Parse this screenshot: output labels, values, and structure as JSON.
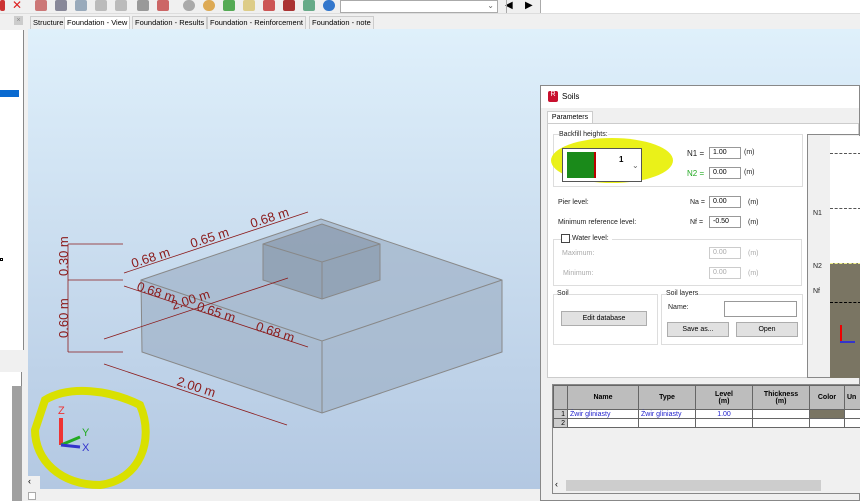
{
  "toolbar": {
    "icons": [
      "close-icon",
      "scissors-icon",
      "copy-icon",
      "paste-icon",
      "undo-icon",
      "redo-icon",
      "frame-icon",
      "table-icon",
      "zoom-icon",
      "zoom-window-icon",
      "axes-icon",
      "note-icon",
      "tools-icon",
      "wrench-icon",
      "users-icon",
      "help-icon"
    ],
    "combo_value": ""
  },
  "tabs": [
    "Structure",
    "Foundation - View",
    "Foundation - Results",
    "Foundation - Reinforcement",
    "Foundation - note"
  ],
  "view": {
    "dims": {
      "h1": "0.30 m",
      "h2": "0.60 m",
      "top1": "0.68 m",
      "top2": "0.65 m",
      "top3": "0.68 m",
      "mid1": "0.68 m",
      "mid2": "0.65 m",
      "mid3": "0.68 m",
      "mid_total": "2.00 m",
      "bottom": "2.00 m"
    },
    "axes": {
      "z": "Z",
      "y": "Y",
      "x": "X"
    }
  },
  "dialog": {
    "title": "Soils",
    "tab": "Parameters",
    "backfill_label": "Backfill heights:",
    "backfill_value": "1",
    "n1_label": "N1 =",
    "n1": "1.00",
    "n2_label": "N2 =",
    "n2": "0.00",
    "unit": "(m)",
    "pier_label": "Pier level:",
    "na_label": "Na =",
    "na": "0.00",
    "minref_label": "Minimum reference level:",
    "nf_label": "Nf =",
    "nf": "-0.50",
    "water_label": "Water level:",
    "max_label": "Maximum:",
    "max": "0.00",
    "min_label": "Minimum:",
    "min": "0.00",
    "soil_group": "Soil",
    "edit_db": "Edit database",
    "layers_group": "Soil layers",
    "name_label": "Name:",
    "name_value": "",
    "save_as": "Save as...",
    "open": "Open",
    "preview_labels": {
      "n1": "N1",
      "n2": "N2",
      "nf": "Nf"
    },
    "table": {
      "headers": [
        "Name",
        "Type",
        "Level\n(m)",
        "Thickness\n(m)",
        "Color",
        "Un"
      ],
      "rows": [
        {
          "num": "1",
          "name": "Żwir gliniasty",
          "type": "Żwir gliniasty",
          "level": "1.00",
          "thickness": "",
          "color": "#7a7563"
        },
        {
          "num": "2",
          "name": "",
          "type": "",
          "level": "",
          "thickness": "",
          "color": ""
        }
      ]
    }
  }
}
